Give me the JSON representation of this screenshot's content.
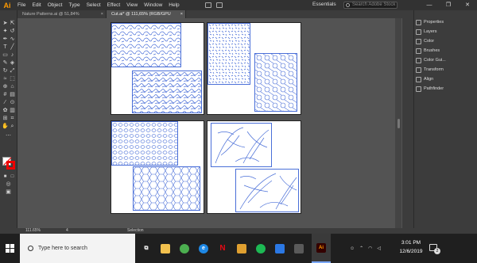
{
  "app": {
    "logo": "Ai",
    "menu": [
      "File",
      "Edit",
      "Object",
      "Type",
      "Select",
      "Effect",
      "View",
      "Window",
      "Help"
    ],
    "workspace": "Essentials",
    "search_placeholder": "Search Adobe Stock",
    "window_controls": [
      "—",
      "❐",
      "✕"
    ]
  },
  "tabs": [
    {
      "label": "Nature Patterns.ai @ 51,84% (RGB/GPU Preview)",
      "close": "×",
      "active": false
    },
    {
      "label": "Cut.ai* @ 111,65% (RGB/GPU Preview)",
      "close": "×",
      "active": true
    }
  ],
  "tools": [
    "select-icon",
    "direct-select-icon",
    "magic-wand-icon",
    "pen-icon",
    "curvature-icon",
    "type-icon",
    "line-icon",
    "rectangle-icon",
    "paintbrush-icon",
    "pencil-icon",
    "eraser-icon",
    "rotate-icon",
    "scale-icon",
    "width-icon",
    "free-transform-icon",
    "shape-builder-icon",
    "perspective-icon",
    "mesh-icon",
    "gradient-icon",
    "eyedropper-icon",
    "blend-icon",
    "symbol-sprayer-icon",
    "graph-icon",
    "artboard-icon",
    "slice-icon",
    "hand-icon",
    "zoom-icon"
  ],
  "panels": [
    {
      "label": "Properties",
      "icon": "properties-icon"
    },
    {
      "label": "Layers",
      "icon": "layers-icon"
    },
    {
      "label": "Color",
      "icon": "color-icon"
    },
    {
      "label": "Brushes",
      "icon": "brushes-icon"
    },
    {
      "label": "Color Gui...",
      "icon": "color-guide-icon"
    },
    {
      "label": "Transform",
      "icon": "transform-icon"
    },
    {
      "label": "Align",
      "icon": "align-icon"
    },
    {
      "label": "Pathfinder",
      "icon": "pathfinder-icon"
    }
  ],
  "status": {
    "zoom": "111.65%",
    "page": "4",
    "tool": "Selection"
  },
  "taskbar": {
    "search_text": "Type here to search",
    "apps": [
      {
        "name": "task-view-icon",
        "glyph": "⧉",
        "color": "#1f1f1f"
      },
      {
        "name": "file-explorer-icon",
        "glyph": "",
        "color": "#f2c14e"
      },
      {
        "name": "chrome-icon",
        "glyph": "",
        "color": "#4caf50"
      },
      {
        "name": "edge-icon",
        "glyph": "e",
        "color": "#1e88e5"
      },
      {
        "name": "netflix-icon",
        "glyph": "N",
        "color": "#1f1f1f"
      },
      {
        "name": "folder-icon",
        "glyph": "",
        "color": "#e0a030"
      },
      {
        "name": "spotify-icon",
        "glyph": "",
        "color": "#1db954"
      },
      {
        "name": "mail-icon",
        "glyph": "",
        "color": "#2b78e4"
      },
      {
        "name": "store-icon",
        "glyph": "",
        "color": "#5a5a5a"
      },
      {
        "name": "illustrator-icon",
        "glyph": "Ai",
        "color": "#330000"
      }
    ],
    "time": "3:01 PM",
    "date": "12/6/2019",
    "notifications": "2"
  }
}
